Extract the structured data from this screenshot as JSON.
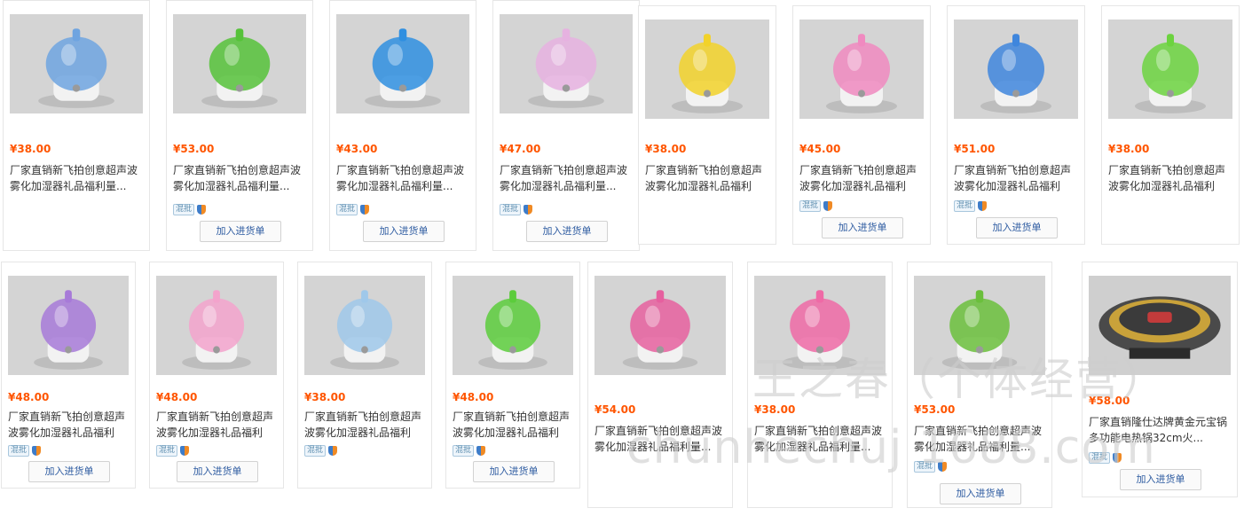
{
  "products": [
    {
      "price": "¥38.00",
      "title": "厂家直销新飞拍创意超声波雾化加湿器礼品福利量...",
      "mixed": false,
      "button": "",
      "color": "#6fa4e0",
      "icon": "elephant-humidifier-image"
    },
    {
      "price": "¥53.00",
      "title": "厂家直销新飞拍创意超声波雾化加湿器礼品福利量...",
      "mixed": true,
      "mixed_label": "混批",
      "button": "加入进货单",
      "color": "#56c23a",
      "icon": "green-vase-humidifier-image"
    },
    {
      "price": "¥43.00",
      "title": "厂家直销新飞拍创意超声波雾化加湿器礼品福利量...",
      "mixed": true,
      "mixed_label": "混批",
      "button": "加入进货单",
      "color": "#2f8fe0",
      "icon": "blue-tank-humidifier-image"
    },
    {
      "price": "¥47.00",
      "title": "厂家直销新飞拍创意超声波雾化加湿器礼品福利量...",
      "mixed": true,
      "mixed_label": "混批",
      "button": "加入进货单",
      "color": "#e6b2e0",
      "icon": "pink-drop-humidifier-image"
    },
    {
      "price": "¥38.00",
      "title": "厂家直销新飞拍创意超声波雾化加湿器礼品福利量...",
      "mixed": false,
      "button": "",
      "color": "#f2d22a",
      "icon": "yellow-cat-humidifier-image"
    },
    {
      "price": "¥45.00",
      "title": "厂家直销新飞拍创意超声波雾化加湿器礼品福利量...",
      "mixed": true,
      "mixed_label": "混批",
      "button": "加入进货单",
      "color": "#f08ac0",
      "icon": "pink-tank-humidifier-image"
    },
    {
      "price": "¥51.00",
      "title": "厂家直销新飞拍创意超声波雾化加湿器礼品福利量...",
      "mixed": true,
      "mixed_label": "混批",
      "button": "加入进货单",
      "color": "#3f86dd",
      "icon": "blue-star-humidifier-image"
    },
    {
      "price": "¥38.00",
      "title": "厂家直销新飞拍创意超声波雾化加湿器礼品福利量...",
      "mixed": false,
      "button": "",
      "color": "#6cd33f",
      "icon": "green-frog-humidifier-image"
    },
    {
      "price": "¥48.00",
      "title": "厂家直销新飞拍创意超声波雾化加湿器礼品福利量...",
      "mixed": true,
      "mixed_label": "混批",
      "button": "加入进货单",
      "color": "#a77ad8",
      "icon": "purple-flower-humidifier-image"
    },
    {
      "price": "¥48.00",
      "title": "厂家直销新飞拍创意超声波雾化加湿器礼品福利量...",
      "mixed": true,
      "mixed_label": "混批",
      "button": "加入进货单",
      "color": "#f3a3cc",
      "icon": "pink-flower-humidifier-image"
    },
    {
      "price": "¥38.00",
      "title": "厂家直销新飞拍创意超声波雾化加湿器礼品福利量...",
      "mixed": true,
      "mixed_label": "混批",
      "button": "",
      "color": "#9fc8ea",
      "icon": "blue-apple-humidifier-image"
    },
    {
      "price": "¥48.00",
      "title": "厂家直销新飞拍创意超声波雾化加湿器礼品福利量...",
      "mixed": true,
      "mixed_label": "混批",
      "button": "加入进货单",
      "color": "#5ccc3c",
      "icon": "green-apple-humidifier-image"
    },
    {
      "price": "¥54.00",
      "title": "厂家直销新飞拍创意超声波雾化加湿器礼品福利量...",
      "mixed": false,
      "button": "",
      "color": "#e6609f",
      "icon": "pink-box-humidifier-image"
    },
    {
      "price": "¥38.00",
      "title": "厂家直销新飞拍创意超声波雾化加湿器礼品福利量...",
      "mixed": false,
      "button": "",
      "color": "#ef6aa6",
      "icon": "pink-pig-humidifier-image"
    },
    {
      "price": "¥53.00",
      "title": "厂家直销新飞拍创意超声波雾化加湿器礼品福利量...",
      "mixed": true,
      "mixed_label": "混批",
      "button": "加入进货单",
      "color": "#6bbf3c",
      "icon": "white-vase-humidifier-image"
    },
    {
      "price": "¥58.00",
      "title": "厂家直销隆仕达牌黄金元宝锅多功能电热锅32cm火...",
      "mixed": true,
      "mixed_label": "混批",
      "button": "加入进货单",
      "color": "#3a3a3a",
      "icon": "electric-hot-pot-image"
    }
  ],
  "watermark": {
    "line1": "王之春（个体经营）",
    "line2": "chunhechuj 1688.com"
  }
}
